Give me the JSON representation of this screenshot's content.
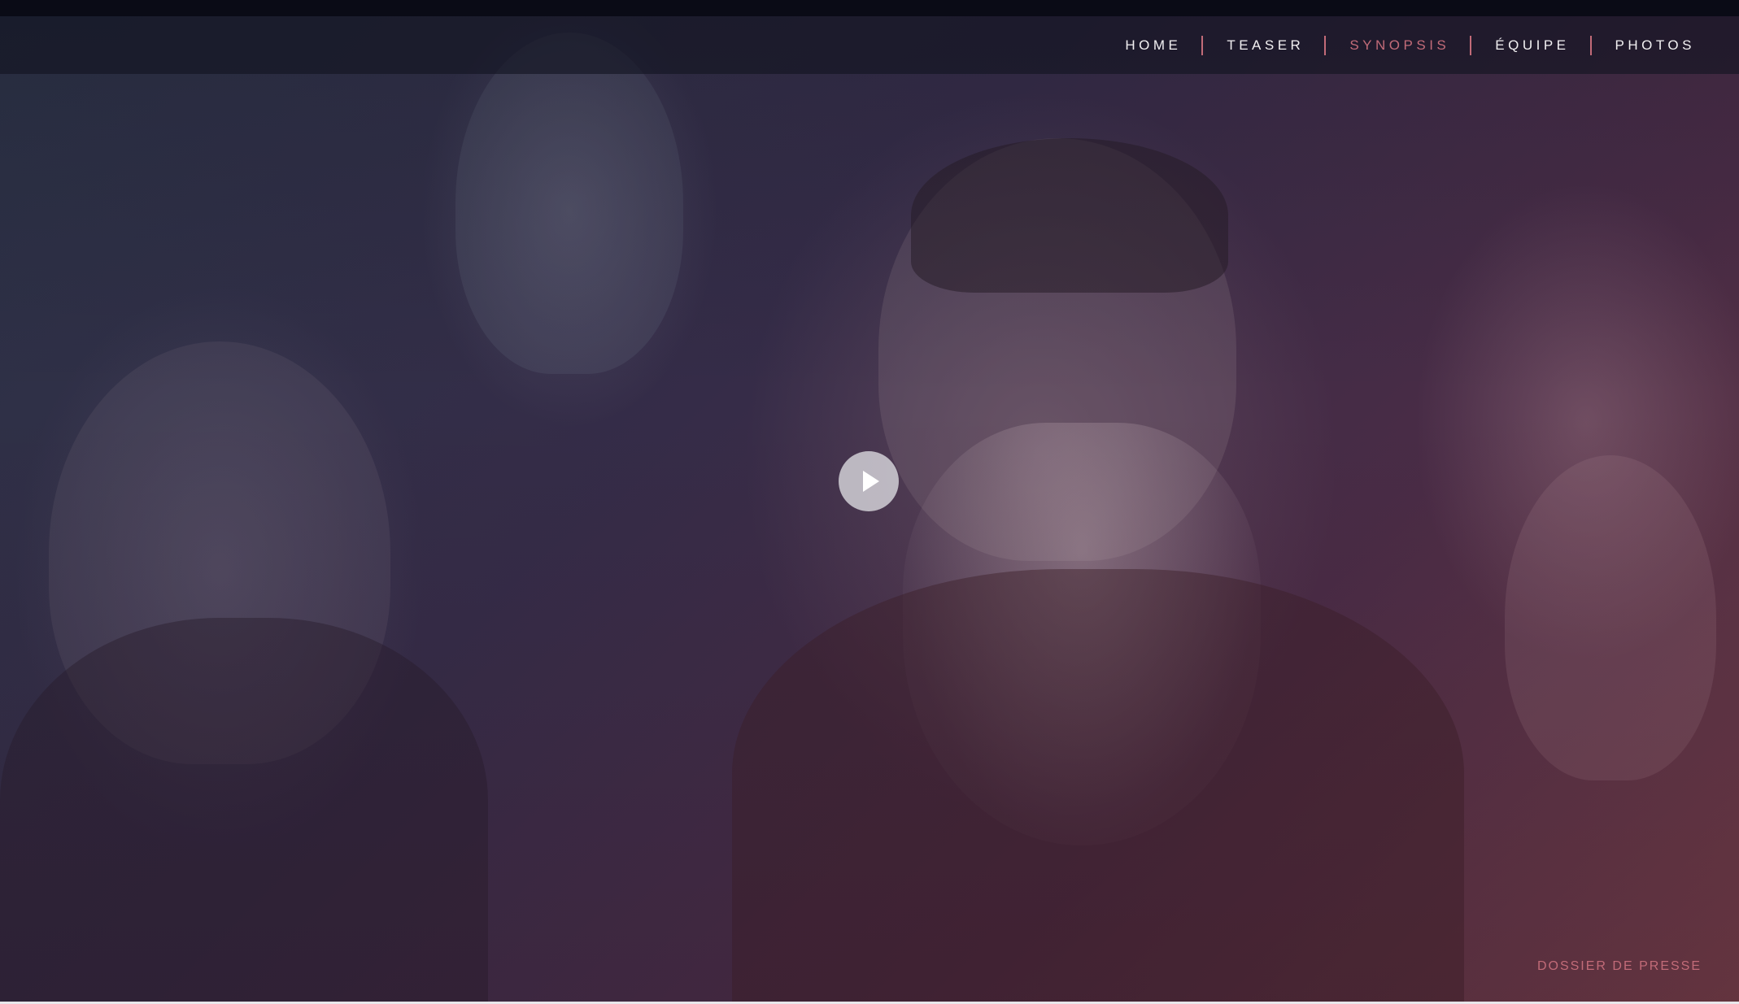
{
  "nav": {
    "items": [
      {
        "label": "HOME",
        "active": false
      },
      {
        "label": "TEASER",
        "active": false
      },
      {
        "label": "SYNOPSIS",
        "active": true
      },
      {
        "label": "ÉQUIPE",
        "active": false
      },
      {
        "label": "PHOTOS",
        "active": false
      }
    ],
    "active_color": "#c26b78",
    "separator_color": "#c26b78"
  },
  "hero": {
    "play_icon": "play-icon"
  },
  "footer": {
    "press_label": "DOSSIER DE PRESSE"
  }
}
